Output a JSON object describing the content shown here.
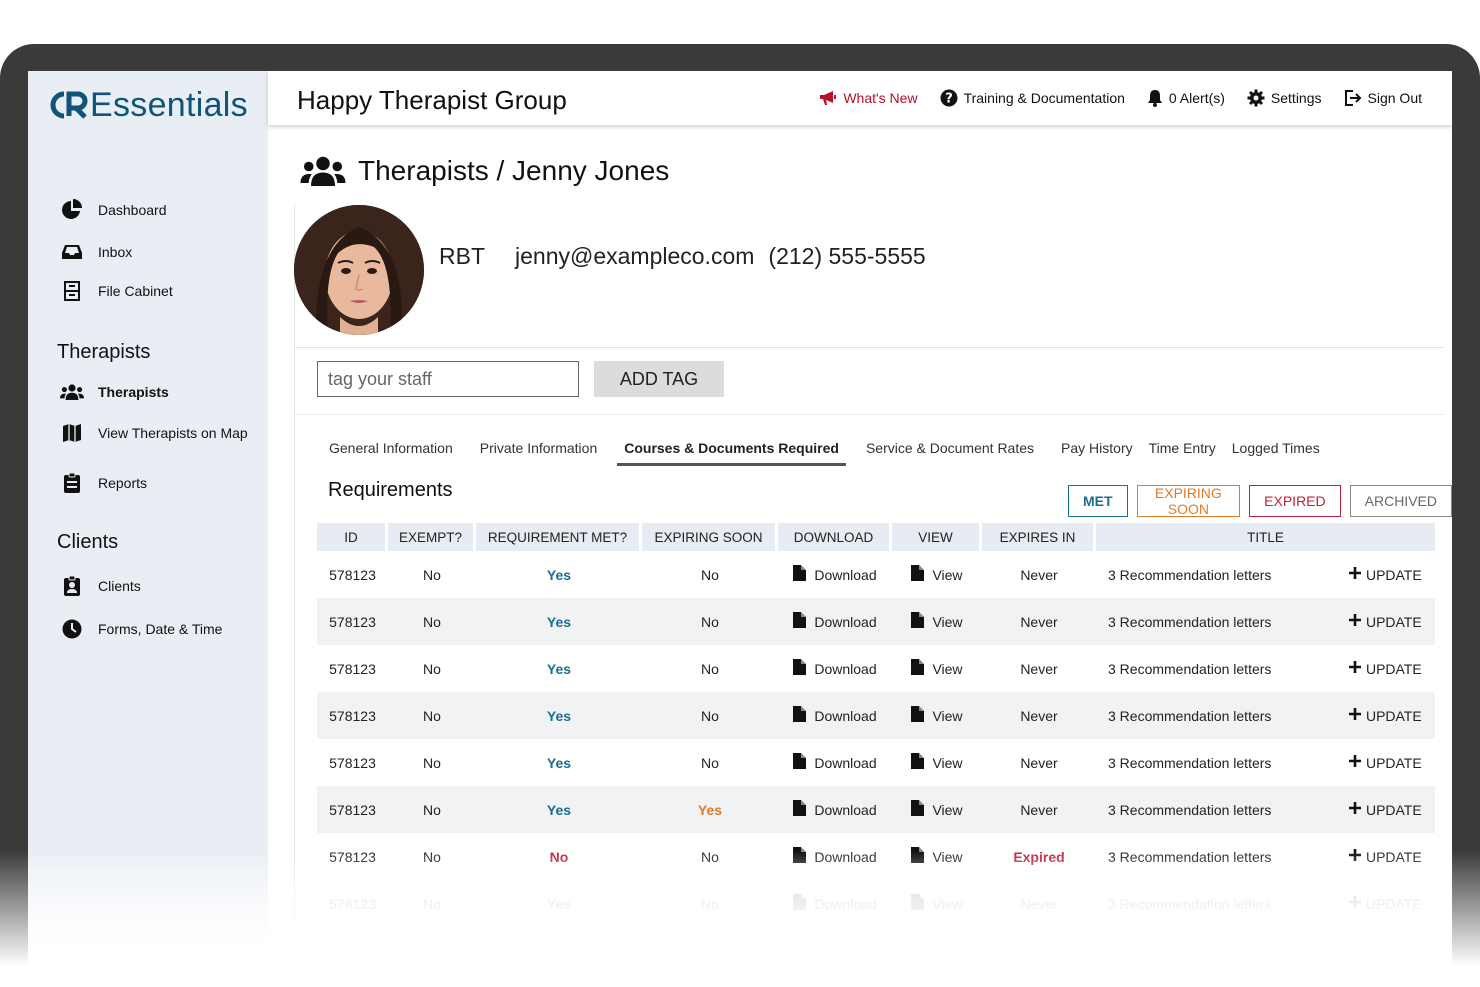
{
  "brand": {
    "logo_text": "Essentials",
    "accent": "#10547a"
  },
  "topbar": {
    "org_name": "Happy Therapist Group",
    "links": [
      {
        "label": "What's New",
        "icon": "megaphone-icon",
        "color": "#b3132b"
      },
      {
        "label": "Training & Documentation",
        "icon": "help-circle-icon"
      },
      {
        "label": "0 Alert(s)",
        "icon": "bell-icon"
      },
      {
        "label": "Settings",
        "icon": "gear-icon"
      },
      {
        "label": "Sign Out",
        "icon": "sign-out-icon"
      }
    ]
  },
  "sidebar": {
    "top_items": [
      {
        "label": "Dashboard",
        "icon": "pie-chart-icon"
      },
      {
        "label": "Inbox",
        "icon": "inbox-icon"
      },
      {
        "label": "File Cabinet",
        "icon": "file-cabinet-icon"
      }
    ],
    "therapists_heading": "Therapists",
    "therapist_items": [
      {
        "label": "Therapists",
        "icon": "users-icon",
        "active": true
      },
      {
        "label": "View Therapists on Map",
        "icon": "map-icon"
      },
      {
        "label": "Reports",
        "icon": "clipboard-icon"
      }
    ],
    "clients_heading": "Clients",
    "client_items": [
      {
        "label": "Clients",
        "icon": "client-badge-icon"
      },
      {
        "label": "Forms, Date & Time",
        "icon": "clock-icon"
      }
    ]
  },
  "page": {
    "breadcrumb": "Therapists / Jenny Jones",
    "profile": {
      "role": "RBT",
      "email": "jenny@exampleco.com",
      "phone": "(212) 555-5555"
    },
    "tag_placeholder": "tag your staff",
    "add_tag_label": "ADD TAG",
    "tabs": [
      "General Information",
      "Private Information",
      "Courses & Documents Required",
      "Service & Document Rates",
      "Pay History",
      "Time Entry",
      "Logged Times"
    ],
    "active_tab": "Courses & Documents Required"
  },
  "requirements": {
    "title": "Requirements",
    "filters": {
      "met": "MET",
      "expiring": "EXPIRING SOON",
      "expired": "EXPIRED",
      "archived": "ARCHIVED"
    },
    "columns": [
      "ID",
      "EXEMPT?",
      "REQUIREMENT MET?",
      "EXPIRING SOON",
      "DOWNLOAD",
      "VIEW",
      "EXPIRES IN",
      "TITLE"
    ],
    "download_label": "Download",
    "view_label": "View",
    "update_label": "UPDATE",
    "rows": [
      {
        "id": "578123",
        "exempt": "No",
        "met": "Yes",
        "expiring": "No",
        "expires": "Never",
        "title": "3 Recommendation letters"
      },
      {
        "id": "578123",
        "exempt": "No",
        "met": "Yes",
        "expiring": "No",
        "expires": "Never",
        "title": "3 Recommendation letters"
      },
      {
        "id": "578123",
        "exempt": "No",
        "met": "Yes",
        "expiring": "No",
        "expires": "Never",
        "title": "3 Recommendation letters"
      },
      {
        "id": "578123",
        "exempt": "No",
        "met": "Yes",
        "expiring": "No",
        "expires": "Never",
        "title": "3 Recommendation letters"
      },
      {
        "id": "578123",
        "exempt": "No",
        "met": "Yes",
        "expiring": "No",
        "expires": "Never",
        "title": "3 Recommendation letters"
      },
      {
        "id": "578123",
        "exempt": "No",
        "met": "Yes",
        "expiring": "Yes",
        "expires": "Never",
        "title": "3 Recommendation letters"
      },
      {
        "id": "578123",
        "exempt": "No",
        "met": "No",
        "expiring": "No",
        "expires": "Expired",
        "title": "3 Recommendation letters"
      },
      {
        "id": "578123",
        "exempt": "No",
        "met": "Yes",
        "expiring": "No",
        "expires": "Never",
        "title": "3 Recommendation letters"
      }
    ]
  }
}
